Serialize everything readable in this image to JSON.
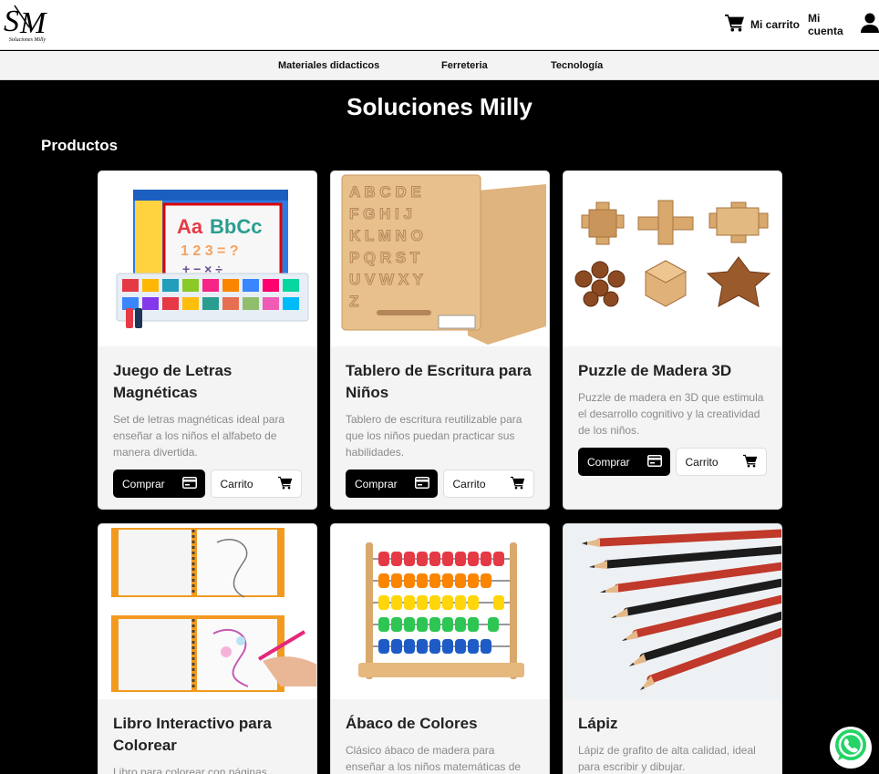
{
  "header": {
    "logo_text": "Soluciones Milly",
    "logo_mark": "SM",
    "cart_label": "Mi carrito",
    "account_label": "Mi cuenta"
  },
  "nav": {
    "items": [
      {
        "label": "Materiales didacticos"
      },
      {
        "label": "Ferreteria"
      },
      {
        "label": "Tecnología"
      }
    ]
  },
  "main": {
    "site_title": "Soluciones Milly",
    "section_title": "Productos"
  },
  "buttons": {
    "buy_label": "Comprar",
    "cart_label": "Carrito"
  },
  "products": [
    {
      "title": "Juego de Letras Magnéticas",
      "description": "Set de letras magnéticas ideal para enseñar a los niños el alfabeto de manera divertida."
    },
    {
      "title": "Tablero de Escritura para Niños",
      "description": "Tablero de escritura reutilizable para que los niños puedan practicar sus habilidades."
    },
    {
      "title": "Puzzle de Madera 3D",
      "description": "Puzzle de madera en 3D que estimula el desarrollo cognitivo y la creatividad de los niños."
    },
    {
      "title": "Libro Interactivo para Colorear",
      "description": "Libro para colorear con páginas"
    },
    {
      "title": "Ábaco de Colores",
      "description": "Clásico ábaco de madera para enseñar a los niños matemáticas de"
    },
    {
      "title": "Lápiz",
      "description": "Lápiz de grafito de alta calidad, ideal para escribir y dibujar."
    }
  ],
  "colors": {
    "page_bg": "#000000",
    "card_bg": "#f4f4f4",
    "buy_button": "#000000",
    "whatsapp": "#25d366"
  },
  "icons": [
    "cart-icon",
    "user-icon",
    "credit-card-icon",
    "whatsapp-icon"
  ]
}
